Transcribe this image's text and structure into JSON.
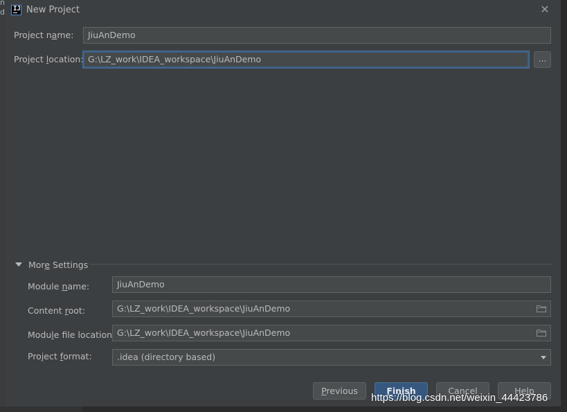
{
  "window": {
    "title": "New Project",
    "app_icon_text": "IJ"
  },
  "form": {
    "project_name": {
      "label_pre": "Project n",
      "label_ul": "a",
      "label_post": "me:",
      "value": "JiuAnDemo"
    },
    "project_location": {
      "label_pre": "Project ",
      "label_ul": "l",
      "label_post": "ocation:",
      "value": "G:\\LZ_work\\IDEA_workspace\\JiuAnDemo",
      "browse_label": "..."
    }
  },
  "more_settings": {
    "header_pre": "Mor",
    "header_ul": "e",
    "header_post": " Settings",
    "module_name": {
      "label_pre": "Module ",
      "label_ul": "n",
      "label_post": "ame:",
      "value": "JiuAnDemo"
    },
    "content_root": {
      "label_pre": "Content ",
      "label_ul": "r",
      "label_post": "oot:",
      "value": "G:\\LZ_work\\IDEA_workspace\\JiuAnDemo"
    },
    "module_file_location": {
      "label_pre": "Modu",
      "label_ul": "l",
      "label_post": "e file location:",
      "value": "G:\\LZ_work\\IDEA_workspace\\JiuAnDemo"
    },
    "project_format": {
      "label_pre": "Project ",
      "label_ul": "f",
      "label_post": "ormat:",
      "value": ".idea (directory based)"
    }
  },
  "buttons": {
    "previous_ul": "P",
    "previous_rest": "revious",
    "finish_ul": "F",
    "finish_rest": "inish",
    "cancel": "Cancel",
    "help": "Help"
  },
  "background": {
    "strip_chars": [
      "n",
      "d"
    ]
  },
  "watermark": "https://blog.csdn.net/weixin_44423786",
  "colors": {
    "dialog_bg": "#3c3f41",
    "field_bg": "#45494a",
    "focus_border": "#3d6185",
    "primary_button": "#365880"
  }
}
